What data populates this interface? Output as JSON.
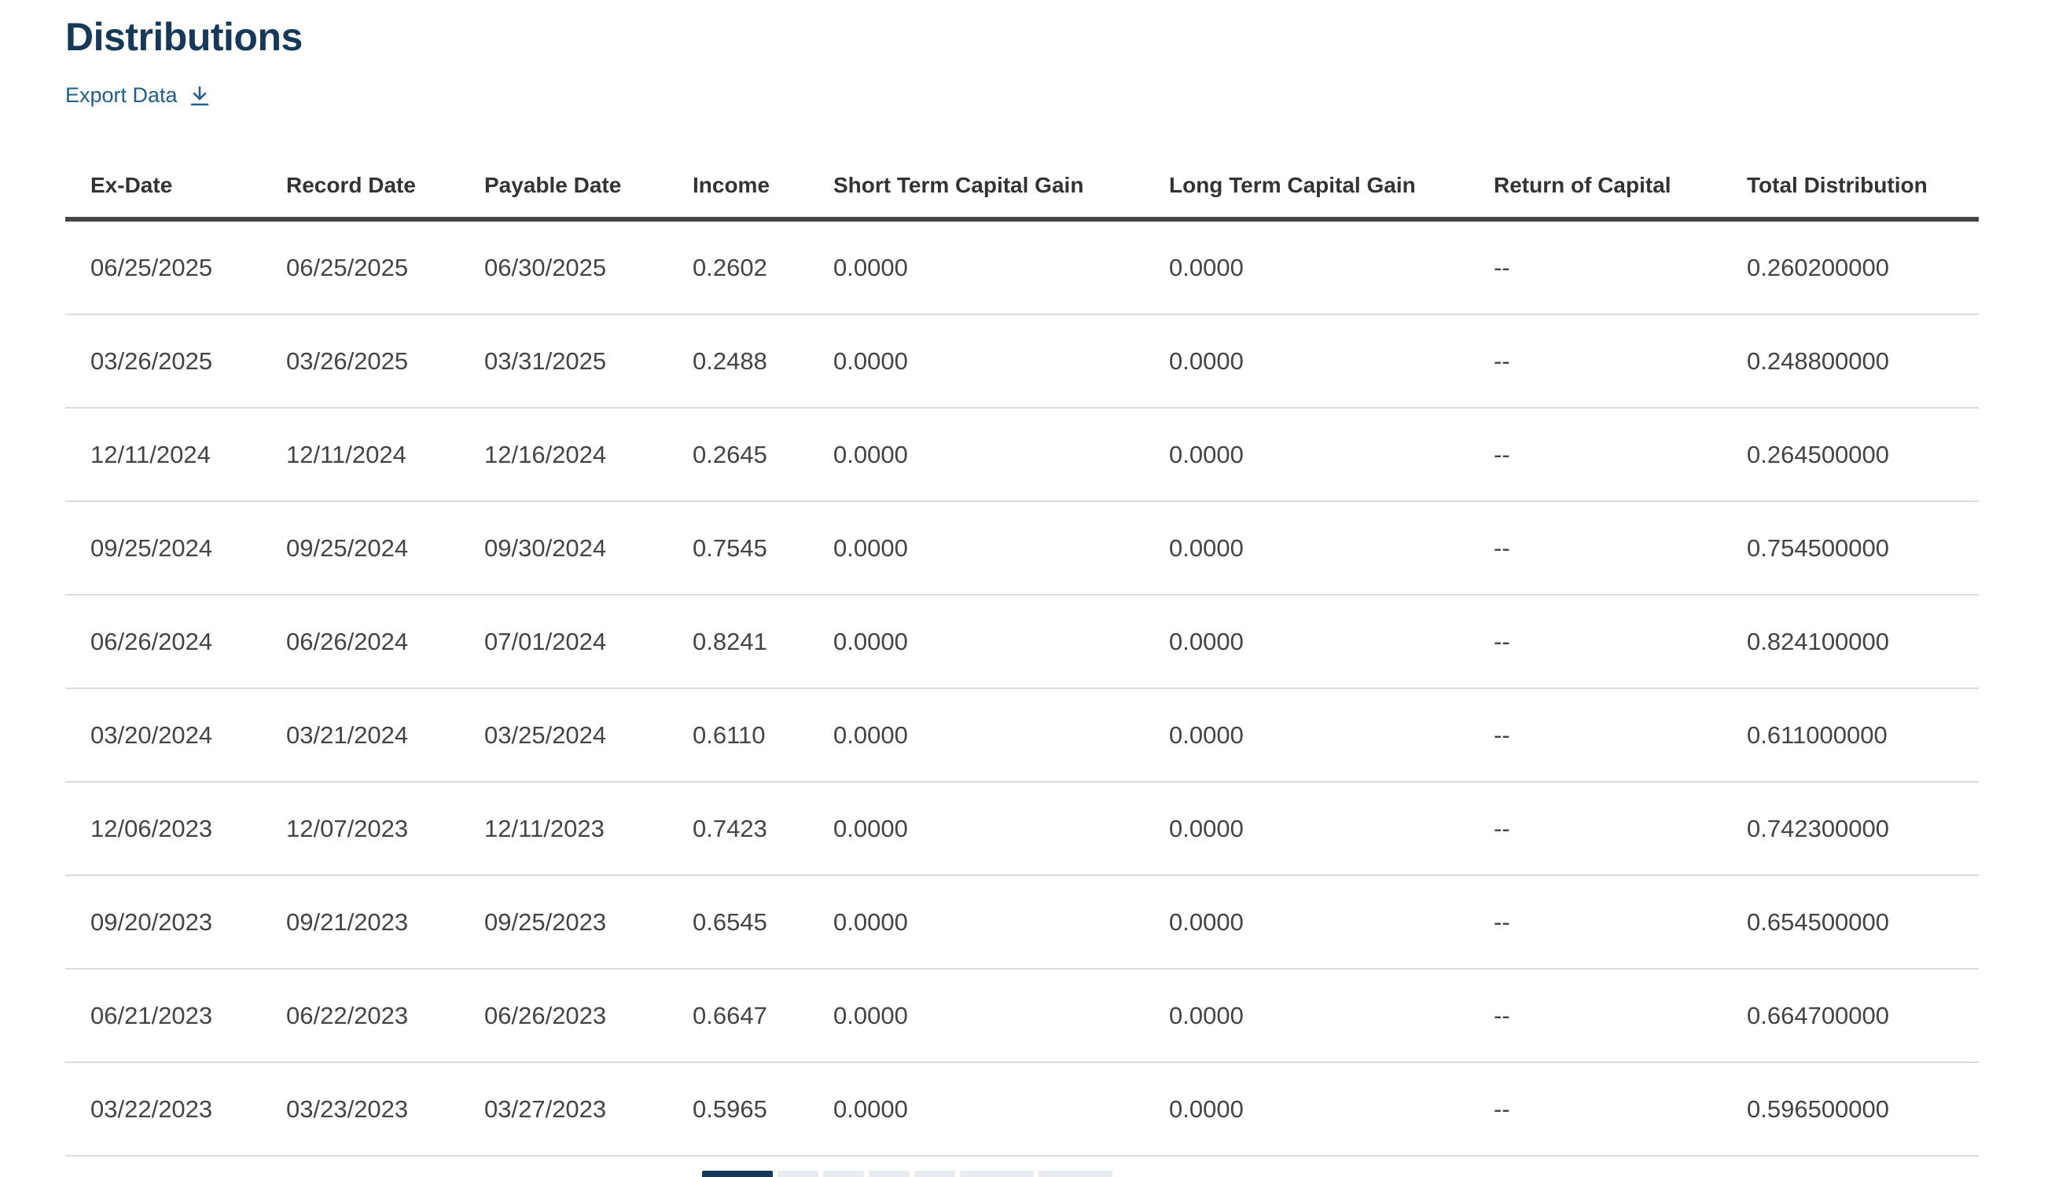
{
  "header": {
    "title": "Distributions",
    "export_label": "Export Data",
    "export_icon": "download-icon"
  },
  "colors": {
    "title": "#16395a",
    "link": "#1f5f8b",
    "header_rule": "#454545",
    "row_rule": "#dcdcdc",
    "pager_active": "#16395a",
    "pager_inactive": "#e9ecef"
  },
  "table": {
    "columns": [
      "Ex-Date",
      "Record Date",
      "Payable Date",
      "Income",
      "Short Term Capital Gain",
      "Long Term Capital Gain",
      "Return of Capital",
      "Total Distribution"
    ],
    "rows": [
      [
        "06/25/2025",
        "06/25/2025",
        "06/30/2025",
        "0.2602",
        "0.0000",
        "0.0000",
        "--",
        "0.260200000"
      ],
      [
        "03/26/2025",
        "03/26/2025",
        "03/31/2025",
        "0.2488",
        "0.0000",
        "0.0000",
        "--",
        "0.248800000"
      ],
      [
        "12/11/2024",
        "12/11/2024",
        "12/16/2024",
        "0.2645",
        "0.0000",
        "0.0000",
        "--",
        "0.264500000"
      ],
      [
        "09/25/2024",
        "09/25/2024",
        "09/30/2024",
        "0.7545",
        "0.0000",
        "0.0000",
        "--",
        "0.754500000"
      ],
      [
        "06/26/2024",
        "06/26/2024",
        "07/01/2024",
        "0.8241",
        "0.0000",
        "0.0000",
        "--",
        "0.824100000"
      ],
      [
        "03/20/2024",
        "03/21/2024",
        "03/25/2024",
        "0.6110",
        "0.0000",
        "0.0000",
        "--",
        "0.611000000"
      ],
      [
        "12/06/2023",
        "12/07/2023",
        "12/11/2023",
        "0.7423",
        "0.0000",
        "0.0000",
        "--",
        "0.742300000"
      ],
      [
        "09/20/2023",
        "09/21/2023",
        "09/25/2023",
        "0.6545",
        "0.0000",
        "0.0000",
        "--",
        "0.654500000"
      ],
      [
        "06/21/2023",
        "06/22/2023",
        "06/26/2023",
        "0.6647",
        "0.0000",
        "0.0000",
        "--",
        "0.664700000"
      ],
      [
        "03/22/2023",
        "03/23/2023",
        "03/27/2023",
        "0.5965",
        "0.0000",
        "0.0000",
        "--",
        "0.596500000"
      ]
    ]
  },
  "pagination": {
    "page_count": 7,
    "active_page": 1
  }
}
